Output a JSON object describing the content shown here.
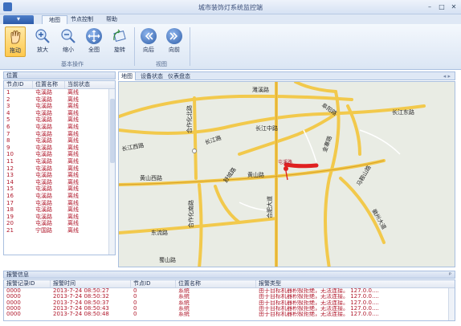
{
  "window": {
    "title": "城市装饰灯系统监控端",
    "minimize": "–",
    "maximize": "□",
    "close": "✕"
  },
  "menu": {
    "app_button": "▾",
    "tabs": [
      "地图",
      "节点控制",
      "帮助"
    ]
  },
  "ribbon": {
    "groups": [
      {
        "label": "基本操作",
        "buttons": [
          "拖动",
          "放大",
          "缩小",
          "全图",
          "旋转"
        ]
      },
      {
        "label": "视图",
        "buttons": [
          "向后",
          "向前"
        ]
      }
    ]
  },
  "left_panel": {
    "title": "位置",
    "columns": [
      "节点ID",
      "位置名称",
      "当前状态"
    ],
    "rows": [
      [
        "1",
        "屯溪路",
        "离线"
      ],
      [
        "2",
        "屯溪路",
        "离线"
      ],
      [
        "3",
        "屯溪路",
        "离线"
      ],
      [
        "4",
        "屯溪路",
        "离线"
      ],
      [
        "5",
        "屯溪路",
        "离线"
      ],
      [
        "6",
        "屯溪路",
        "离线"
      ],
      [
        "7",
        "屯溪路",
        "离线"
      ],
      [
        "8",
        "屯溪路",
        "离线"
      ],
      [
        "9",
        "屯溪路",
        "离线"
      ],
      [
        "10",
        "屯溪路",
        "离线"
      ],
      [
        "11",
        "屯溪路",
        "离线"
      ],
      [
        "12",
        "屯溪路",
        "离线"
      ],
      [
        "13",
        "屯溪路",
        "离线"
      ],
      [
        "14",
        "屯溪路",
        "离线"
      ],
      [
        "15",
        "屯溪路",
        "离线"
      ],
      [
        "16",
        "屯溪路",
        "离线"
      ],
      [
        "17",
        "屯溪路",
        "离线"
      ],
      [
        "18",
        "屯溪路",
        "离线"
      ],
      [
        "19",
        "屯溪路",
        "离线"
      ],
      [
        "20",
        "屯溪路",
        "离线"
      ],
      [
        "21",
        "宁国路",
        "离线"
      ]
    ]
  },
  "map_tabs": [
    "地图",
    "设备状态",
    "仪表盘态"
  ],
  "map_nav": "◂ ▸",
  "map": {
    "roads": [
      "濉溪路",
      "阜阳路",
      "长江中路",
      "长江西路",
      "长江路",
      "长江东路",
      "金寨路",
      "黄山西路",
      "黄山路",
      "合作化南路",
      "合作化北路",
      "舒城路",
      "马鞍山路",
      "合肥大道",
      "东流路",
      "蜀山路",
      "徽州大道"
    ],
    "marker_label": "屯溪路"
  },
  "alarm_panel": {
    "title": "报警信息",
    "pin": "ᵖ",
    "columns": [
      "报警记录ID",
      "报警时间",
      "节点ID",
      "位置名称",
      "报警类型"
    ],
    "rows": [
      [
        "0000",
        "2013-7-24 08:50:27",
        "0",
        "系统",
        "由于目标机器积极拒绝，无法连接。 127.0.0...."
      ],
      [
        "0000",
        "2013-7-24 08:50:32",
        "0",
        "系统",
        "由于目标机器积极拒绝，无法连接。 127.0.0...."
      ],
      [
        "0000",
        "2013-7-24 08:50:37",
        "0",
        "系统",
        "由于目标机器积极拒绝，无法连接。 127.0.0...."
      ],
      [
        "0000",
        "2013-7-24 08:50:43",
        "0",
        "系统",
        "由于目标机器积极拒绝，无法连接。 127.0.0...."
      ],
      [
        "0000",
        "2013-7-24 08:50:48",
        "0",
        "系统",
        "由于目标机器积极拒绝，无法连接。 127.0.0...."
      ]
    ]
  }
}
